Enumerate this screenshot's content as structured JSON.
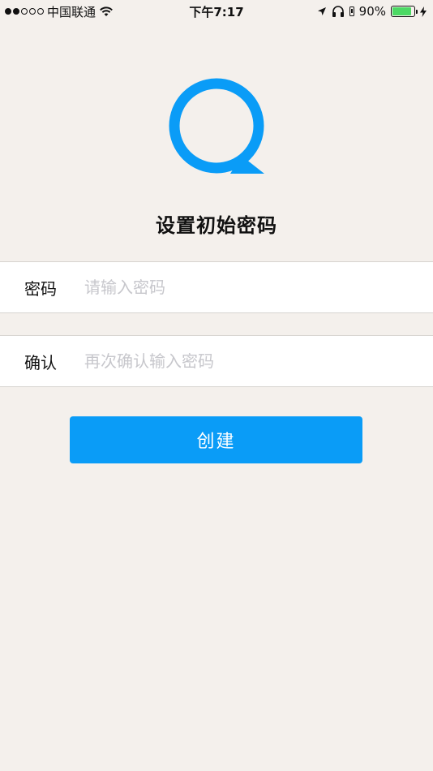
{
  "status_bar": {
    "carrier": "中国联通",
    "signal_dots": [
      true,
      true,
      false,
      false,
      false
    ],
    "time": "下午7:17",
    "battery_percent": "90%",
    "battery_level": 0.9,
    "icons": [
      "wifi-icon",
      "location-arrow-icon",
      "headphones-icon",
      "battery-icon",
      "charging-bolt-icon"
    ]
  },
  "logo": {
    "icon": "chat-bubble-logo-icon"
  },
  "title": "设置初始密码",
  "fields": [
    {
      "label": "密码",
      "value": "",
      "placeholder": "请输入密码"
    },
    {
      "label": "确认",
      "value": "",
      "placeholder": "再次确认输入密码"
    }
  ],
  "create_button": {
    "label": "创建"
  },
  "colors": {
    "background": "#f4f0ec",
    "accent": "#0a9cf7",
    "battery": "#4cd964",
    "placeholder": "#c7c7cc"
  }
}
